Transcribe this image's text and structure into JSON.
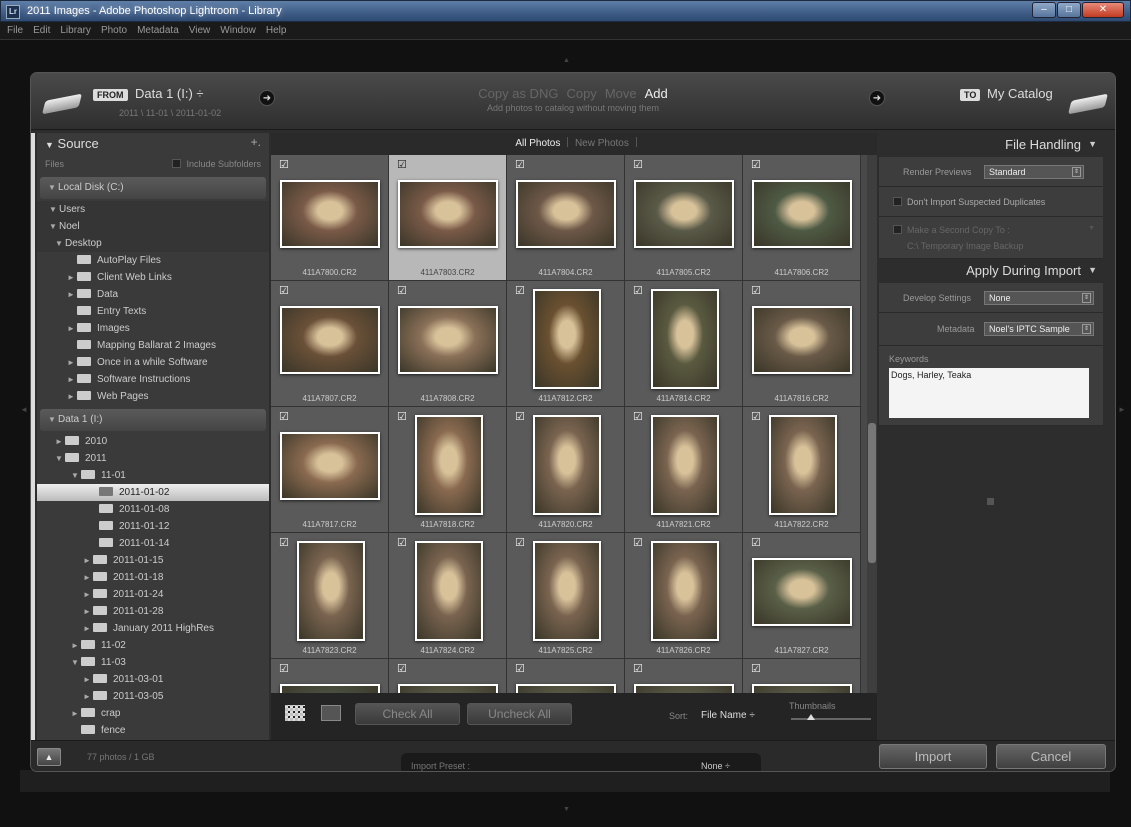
{
  "window": {
    "title": "2011 Images - Adobe Photoshop Lightroom - Library",
    "icon": "Lr"
  },
  "menu": [
    "File",
    "Edit",
    "Library",
    "Photo",
    "Metadata",
    "View",
    "Window",
    "Help"
  ],
  "header": {
    "from_badge": "FROM",
    "source_name": "Data 1 (I:) ÷",
    "source_path": "2011 \\ 11-01 \\ 2011-01-02",
    "modes": [
      "Copy as DNG",
      "Copy",
      "Move",
      "Add"
    ],
    "active_mode": "Add",
    "mode_description": "Add photos to catalog without moving them",
    "to_badge": "TO",
    "dest_name": "My Catalog"
  },
  "source_panel": {
    "title": "Source",
    "plus": "+.",
    "files_label": "Files",
    "include_subfolders": "Include Subfolders",
    "local_disk": "Local Disk (C:)",
    "local_tree": [
      {
        "label": "Users",
        "tw": "▼",
        "indent": 10,
        "folder": false,
        "sub": true
      },
      {
        "label": "Noel",
        "tw": "▼",
        "indent": 10,
        "folder": false,
        "sub": true
      },
      {
        "label": "Desktop",
        "tw": "▼",
        "indent": 16,
        "folder": false,
        "sub": true
      },
      {
        "label": "AutoPlay Files",
        "tw": "",
        "indent": 28,
        "folder": true
      },
      {
        "label": "Client Web Links",
        "tw": "►",
        "indent": 28,
        "folder": true
      },
      {
        "label": "Data",
        "tw": "►",
        "indent": 28,
        "folder": true
      },
      {
        "label": "Entry Texts",
        "tw": "",
        "indent": 28,
        "folder": true
      },
      {
        "label": "Images",
        "tw": "►",
        "indent": 28,
        "folder": true
      },
      {
        "label": "Mapping Ballarat 2 Images",
        "tw": "",
        "indent": 28,
        "folder": true
      },
      {
        "label": "Once in a while Software",
        "tw": "►",
        "indent": 28,
        "folder": true
      },
      {
        "label": "Software Instructions",
        "tw": "►",
        "indent": 28,
        "folder": true
      },
      {
        "label": "Web Pages",
        "tw": "►",
        "indent": 28,
        "folder": true
      }
    ],
    "data_disk": "Data 1 (I:)",
    "data_tree": [
      {
        "label": "2010",
        "tw": "►",
        "indent": 16
      },
      {
        "label": "2011",
        "tw": "▼",
        "indent": 16
      },
      {
        "label": "11-01",
        "tw": "▼",
        "indent": 32
      },
      {
        "label": "2011-01-02",
        "tw": "",
        "indent": 50,
        "sel": true
      },
      {
        "label": "2011-01-08",
        "tw": "",
        "indent": 50
      },
      {
        "label": "2011-01-12",
        "tw": "",
        "indent": 50
      },
      {
        "label": "2011-01-14",
        "tw": "",
        "indent": 50
      },
      {
        "label": "2011-01-15",
        "tw": "►",
        "indent": 44
      },
      {
        "label": "2011-01-18",
        "tw": "►",
        "indent": 44
      },
      {
        "label": "2011-01-24",
        "tw": "►",
        "indent": 44
      },
      {
        "label": "2011-01-28",
        "tw": "►",
        "indent": 44
      },
      {
        "label": "January 2011 HighRes",
        "tw": "►",
        "indent": 44
      },
      {
        "label": "11-02",
        "tw": "►",
        "indent": 32
      },
      {
        "label": "11-03",
        "tw": "▼",
        "indent": 32
      },
      {
        "label": "2011-03-01",
        "tw": "►",
        "indent": 44
      },
      {
        "label": "2011-03-05",
        "tw": "►",
        "indent": 44
      },
      {
        "label": "crap",
        "tw": "►",
        "indent": 32
      },
      {
        "label": "fence",
        "tw": "",
        "indent": 32
      }
    ]
  },
  "grid": {
    "tabs": [
      "All Photos",
      "New Photos"
    ],
    "active_tab": "All Photos",
    "photos": [
      {
        "name": "411A7800.CR2",
        "orient": "land",
        "tone": "#7a5a48"
      },
      {
        "name": "411A7803.CR2",
        "orient": "land",
        "tone": "#7a5a48",
        "selected": true
      },
      {
        "name": "411A7804.CR2",
        "orient": "land",
        "tone": "#6e5848"
      },
      {
        "name": "411A7805.CR2",
        "orient": "land",
        "tone": "#5a5a48"
      },
      {
        "name": "411A7806.CR2",
        "orient": "land",
        "tone": "#4e5a44"
      },
      {
        "name": "411A7807.CR2",
        "orient": "land",
        "tone": "#6a5038"
      },
      {
        "name": "411A7808.CR2",
        "orient": "land",
        "tone": "#8a7058"
      },
      {
        "name": "411A7812.CR2",
        "orient": "port",
        "tone": "#6a5030"
      },
      {
        "name": "411A7814.CR2",
        "orient": "port",
        "tone": "#5a5a40"
      },
      {
        "name": "411A7816.CR2",
        "orient": "land",
        "tone": "#6a5a48"
      },
      {
        "name": "411A7817.CR2",
        "orient": "land",
        "tone": "#8a6a50"
      },
      {
        "name": "411A7818.CR2",
        "orient": "port",
        "tone": "#8a6a50"
      },
      {
        "name": "411A7820.CR2",
        "orient": "port",
        "tone": "#7a6450"
      },
      {
        "name": "411A7821.CR2",
        "orient": "port",
        "tone": "#7a6450"
      },
      {
        "name": "411A7822.CR2",
        "orient": "port",
        "tone": "#7a6450"
      },
      {
        "name": "411A7823.CR2",
        "orient": "port",
        "tone": "#7a6450"
      },
      {
        "name": "411A7824.CR2",
        "orient": "port",
        "tone": "#7a6450"
      },
      {
        "name": "411A7825.CR2",
        "orient": "port",
        "tone": "#7a6450"
      },
      {
        "name": "411A7826.CR2",
        "orient": "port",
        "tone": "#7a6450"
      },
      {
        "name": "411A7827.CR2",
        "orient": "land",
        "tone": "#5a6048"
      },
      {
        "name": "",
        "orient": "land",
        "tone": "#4a5040"
      },
      {
        "name": "",
        "orient": "land",
        "tone": "#5a5a48"
      },
      {
        "name": "",
        "orient": "land",
        "tone": "#5a5a48"
      },
      {
        "name": "",
        "orient": "land",
        "tone": "#5a5a48"
      },
      {
        "name": "",
        "orient": "land",
        "tone": "#5a5a48"
      }
    ],
    "check_all": "Check All",
    "uncheck_all": "Uncheck All",
    "sort_label": "Sort:",
    "sort_value": "File Name ÷",
    "thumbnails_label": "Thumbnails",
    "thumbnail_size": 0.25
  },
  "file_handling": {
    "title": "File Handling",
    "render_previews_label": "Render Previews",
    "render_previews_value": "Standard",
    "dont_import_duplicates": "Don't Import Suspected Duplicates",
    "second_copy": "Make a Second Copy To :",
    "second_copy_path": "C:\\ Temporary Image Backup"
  },
  "apply_during_import": {
    "title": "Apply During Import",
    "develop_label": "Develop Settings",
    "develop_value": "None",
    "metadata_label": "Metadata",
    "metadata_value": "Noel's IPTC Sample",
    "keywords_label": "Keywords",
    "keywords_value": "Dogs, Harley, Teaka"
  },
  "bottom": {
    "photos_count": "77 photos / 1 GB",
    "preset_label": "Import Preset :",
    "preset_value": "None ÷",
    "import": "Import",
    "cancel": "Cancel"
  }
}
